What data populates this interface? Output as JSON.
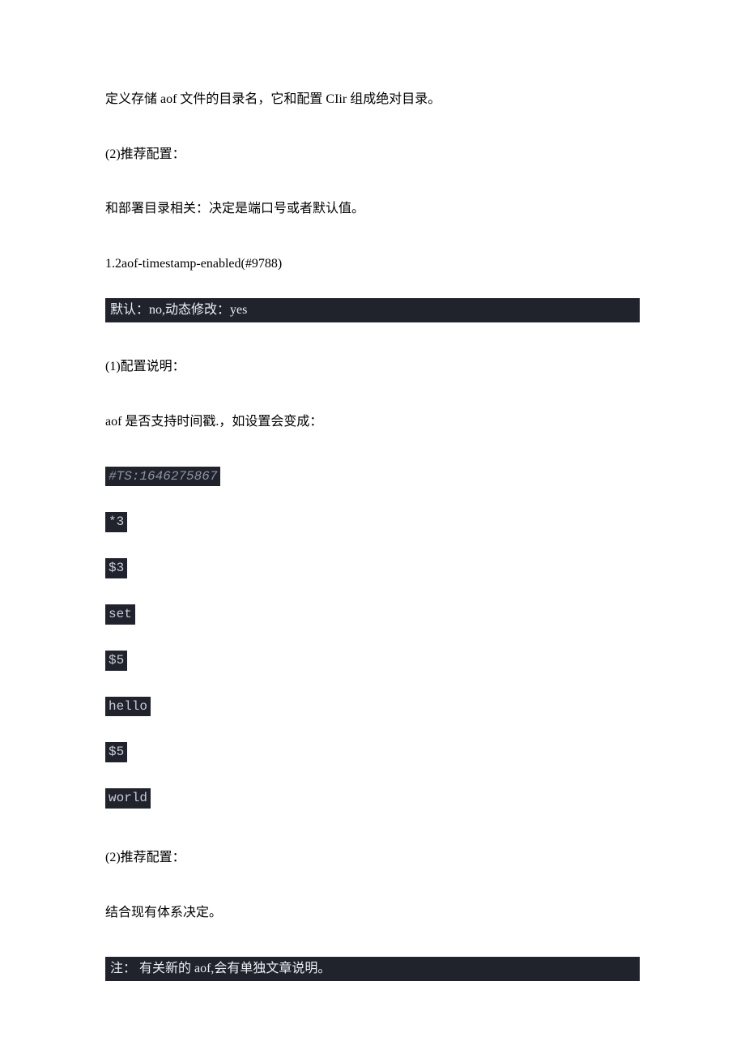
{
  "paragraphs": {
    "p1": "定义存储 aof 文件的目录名，它和配置 CIir 组成绝对目录。",
    "p2": "(2)推荐配置：",
    "p3": "和部署目录相关：决定是端口号或者默认值。",
    "p4": "1.2aof-timestamp-enabled(#9788)",
    "bar1": "默认：no,动态修改：yes",
    "p5": "(1)配置说明：",
    "p6": "aof 是否支持时间戳.，如设置会变成：",
    "code": {
      "l1": "#TS:1646275867",
      "l2": "*3",
      "l3": "$3",
      "l4": "set",
      "l5": "$5",
      "l6": "hello",
      "l7": "$5",
      "l8": "world"
    },
    "p7": "(2)推荐配置：",
    "p8": "结合现有体系决定。",
    "bar2": "注： 有关新的 aof,会有单独文章说明。"
  }
}
